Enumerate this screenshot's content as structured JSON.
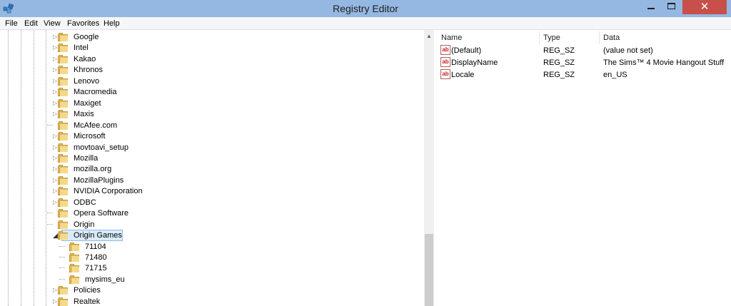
{
  "window": {
    "title": "Registry Editor",
    "close_glyph": "✕"
  },
  "menu": [
    "File",
    "Edit",
    "View",
    "Favorites",
    "Help"
  ],
  "tree": {
    "items": [
      {
        "label": "Google",
        "expandable": true
      },
      {
        "label": "Intel",
        "expandable": true
      },
      {
        "label": "Kakao",
        "expandable": true
      },
      {
        "label": "Khronos",
        "expandable": true
      },
      {
        "label": "Lenovo",
        "expandable": true
      },
      {
        "label": "Macromedia",
        "expandable": true
      },
      {
        "label": "Maxiget",
        "expandable": true
      },
      {
        "label": "Maxis",
        "expandable": true
      },
      {
        "label": "McAfee.com",
        "expandable": false
      },
      {
        "label": "Microsoft",
        "expandable": true
      },
      {
        "label": "movtoavi_setup",
        "expandable": true
      },
      {
        "label": "Mozilla",
        "expandable": true
      },
      {
        "label": "mozilla.org",
        "expandable": true
      },
      {
        "label": "MozillaPlugins",
        "expandable": true
      },
      {
        "label": "NVIDIA Corporation",
        "expandable": true
      },
      {
        "label": "ODBC",
        "expandable": true
      },
      {
        "label": "Opera Software",
        "expandable": false
      },
      {
        "label": "Origin",
        "expandable": false
      },
      {
        "label": "Origin Games",
        "expandable": true,
        "expanded": true,
        "selected": true
      },
      {
        "label": "71104",
        "child": true
      },
      {
        "label": "71480",
        "child": true
      },
      {
        "label": "71715",
        "child": true
      },
      {
        "label": "mysims_eu",
        "child": true
      },
      {
        "label": "Policies",
        "expandable": true
      },
      {
        "label": "Realtek",
        "expandable": true
      }
    ]
  },
  "values": {
    "columns": {
      "name": "Name",
      "type": "Type",
      "data": "Data"
    },
    "icon_text": "ab",
    "rows": [
      {
        "name": "(Default)",
        "type": "REG_SZ",
        "data": "(value not set)"
      },
      {
        "name": "DisplayName",
        "type": "REG_SZ",
        "data": "The Sims™ 4 Movie Hangout Stuff"
      },
      {
        "name": "Locale",
        "type": "REG_SZ",
        "data": "en_US"
      }
    ]
  }
}
